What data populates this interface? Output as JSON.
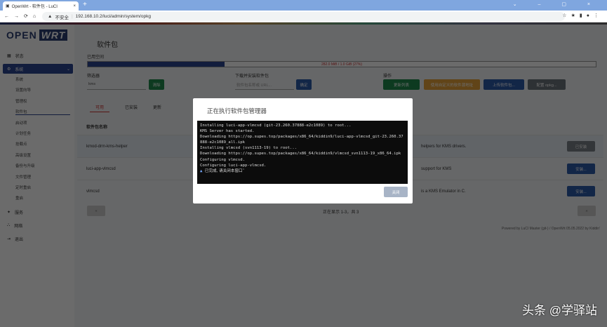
{
  "browser": {
    "tab_title": "OpenWrt - 软件包 - LuCI",
    "not_secure": "不安全",
    "url": "192.168.10.2/luci/admin/system/opkg"
  },
  "sidebar": {
    "logo_left": "OPEN",
    "logo_right": "WRT",
    "items": [
      {
        "label": "状态"
      },
      {
        "label": "系统"
      },
      {
        "label": "服务"
      },
      {
        "label": "网络"
      },
      {
        "label": "退出"
      }
    ],
    "sub_items": [
      "系统",
      "设置向导",
      "管理权",
      "软件包",
      "启动项",
      "计划任务",
      "挂载点",
      "高级设置",
      "备份与升级",
      "文件管理",
      "定时重启",
      "重启"
    ]
  },
  "main": {
    "title": "软件包",
    "disk_label": "已用空间",
    "disk_text": "282.0 MiB / 1.0 GiB (27%)",
    "disk_percent": 27,
    "filter_label": "筛选器",
    "filter_value": "kms",
    "clear_btn": "清除",
    "download_label": "下载并安装软件包",
    "download_placeholder": "软件包名称或 URL...",
    "ok_btn": "确定",
    "actions_label": "操作",
    "update_btn": "更新列表",
    "custom_feed_btn": "使用自定义的软件源地址",
    "upload_btn": "上传软件包...",
    "config_btn": "配置 opkg...",
    "tabs": [
      "可用",
      "已安装",
      "更新"
    ],
    "col_name": "软件包名称",
    "rows": [
      {
        "name": "kmod-drm-kms-helper",
        "desc": "helpers for KMS drivers.",
        "action": "已安装"
      },
      {
        "name": "luci-app-vlmcsd",
        "desc": "support for KMS",
        "action": "安装..."
      },
      {
        "name": "vlmcsd",
        "desc": "is a KMS Emulator in C.",
        "action": "安装..."
      }
    ],
    "pager_prev": "«",
    "pager_next": "»",
    "pager_text": "正在显示 1-3，共 3",
    "footer": "Powered by LuCI Master (git-) / OpenWrt 05.05.2022 by Kiddin'"
  },
  "modal": {
    "title": "正在执行软件包管理器",
    "log": "Installing luci-app-vlmcsd (git-23.260.37888-e2c1089) to root...\nKMS Server has started.\nDownloading https://op.supes.top/packages/x86_64/kiddin9/luci-app-vlmcsd_git-23.260.37888-e2c1089_all.ipk\nInstalling vlmcsd (svn1113-19) to root...\nDownloading https://op.supes.top/packages/x86_64/kiddin9/vlmcsd_svn1113-19_x86_64.ipk\nConfiguring vlmcsd.\nConfiguring luci-app-vlmcsd.",
    "done": "已完成, 请关闭本窗口˜",
    "close_btn": "关闭"
  },
  "watermark": "头条 @学驿站"
}
